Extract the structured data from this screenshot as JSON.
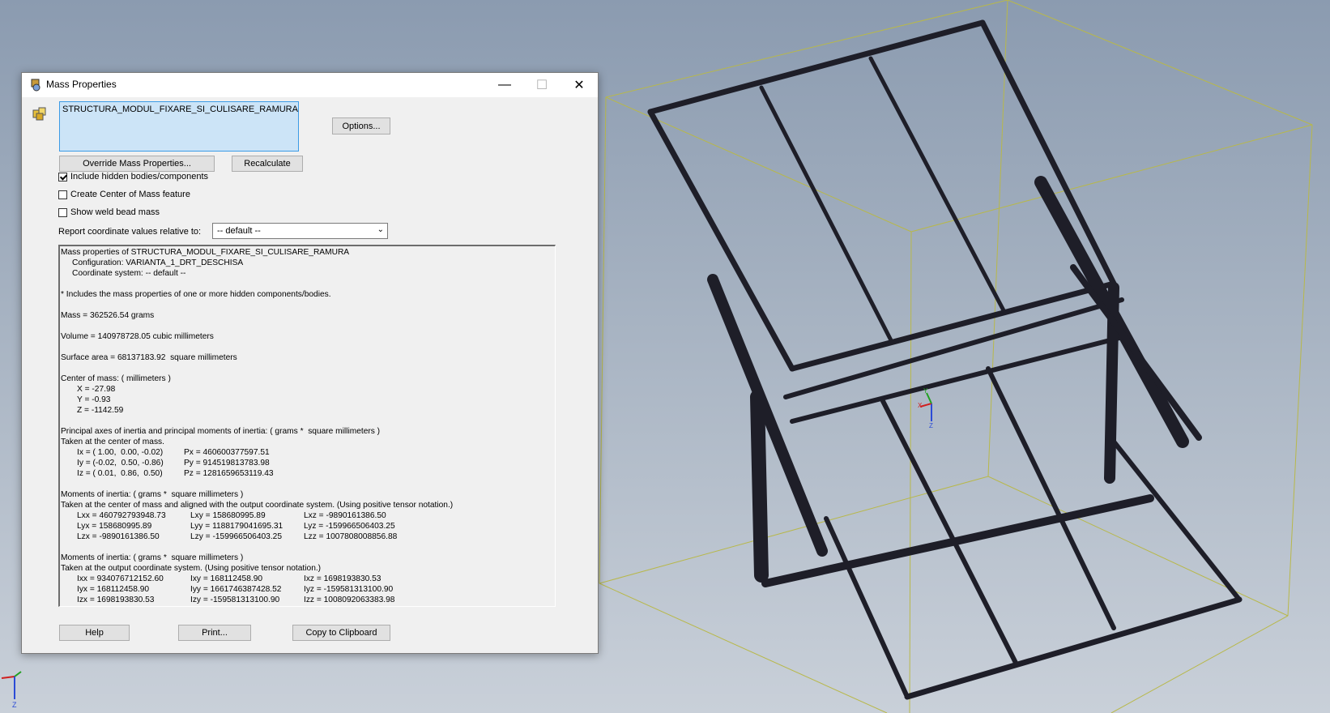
{
  "dialog": {
    "title": "Mass Properties",
    "file": "STRUCTURA_MODUL_FIXARE_SI_CULISARE_RAMURA.SLDASM",
    "options_label": "Options...",
    "override_label": "Override Mass Properties...",
    "recalculate_label": "Recalculate",
    "include_hidden_label": "Include hidden bodies/components",
    "include_hidden_checked": true,
    "create_com_label": "Create Center of Mass feature",
    "create_com_checked": false,
    "show_weld_label": "Show weld bead mass",
    "show_weld_checked": false,
    "report_label": "Report coordinate values relative to:",
    "coord_value": "-- default --",
    "help_label": "Help",
    "print_label": "Print...",
    "clipboard_label": "Copy to Clipboard"
  },
  "results": {
    "header": "Mass properties of STRUCTURA_MODUL_FIXARE_SI_CULISARE_RAMURA",
    "configuration": "Configuration: VARIANTA_1_DRT_DESCHISA",
    "coord_system": "Coordinate system: -- default --",
    "hidden_note": "* Includes the mass properties of one or more hidden components/bodies.",
    "mass": "Mass = 362526.54 grams",
    "volume": "Volume = 140978728.05 cubic millimeters",
    "surface": "Surface area = 68137183.92  square millimeters",
    "com_title": "Center of mass: ( millimeters )",
    "com_x": "X = -27.98",
    "com_y": "Y = -0.93",
    "com_z": "Z = -1142.59",
    "principal_title": "Principal axes of inertia and principal moments of inertia: ( grams *  square millimeters )",
    "principal_sub": "Taken at the center of mass.",
    "ix": "Ix = ( 1.00,  0.00, -0.02)",
    "iy": "Iy = (-0.02,  0.50, -0.86)",
    "iz": "Iz = ( 0.01,  0.86,  0.50)",
    "px": "Px = 460600377597.51",
    "py": "Py = 914519813783.98",
    "pz": "Pz = 1281659653119.43",
    "moi_title1": "Moments of inertia: ( grams *  square millimeters )",
    "moi_sub1": "Taken at the center of mass and aligned with the output coordinate system. (Using positive tensor notation.)",
    "L": [
      [
        "Lxx = 460792793948.73",
        "Lxy = 158680995.89",
        "Lxz = -9890161386.50"
      ],
      [
        "Lyx = 158680995.89",
        "Lyy = 1188179041695.31",
        "Lyz = -159966506403.25"
      ],
      [
        "Lzx = -9890161386.50",
        "Lzy = -159966506403.25",
        "Lzz = 1007808008856.88"
      ]
    ],
    "moi_title2": "Moments of inertia: ( grams *  square millimeters )",
    "moi_sub2": "Taken at the output coordinate system. (Using positive tensor notation.)",
    "I": [
      [
        "Ixx = 934076712152.60",
        "Ixy = 168112458.90",
        "Ixz = 1698193830.53"
      ],
      [
        "Iyx = 168112458.90",
        "Iyy = 1661746387428.52",
        "Iyz = -159581313100.90"
      ],
      [
        "Izx = 1698193830.53",
        "Izy = -159581313100.90",
        "Izz = 1008092063383.98"
      ]
    ]
  },
  "triad": {
    "x": "X",
    "y": "Y",
    "z": "Z"
  },
  "colors": {
    "background_top": "#8b9bb0",
    "bounding_box": "#b8b84a",
    "frame": "#1e1e28",
    "selection": "#cce4f7"
  }
}
